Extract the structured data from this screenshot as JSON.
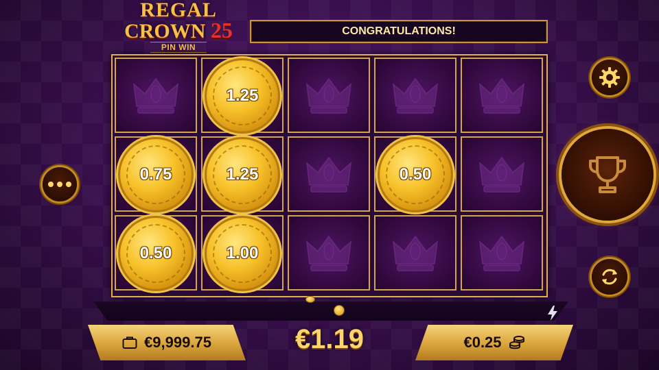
{
  "logo": {
    "line1": "REGAL",
    "line2": "CROWN",
    "number": "25",
    "tagline": "PIN WIN"
  },
  "banner": {
    "text": "CONGRATULATIONS!"
  },
  "grid": {
    "columns": 5,
    "rows": 3,
    "coins": [
      {
        "row": 0,
        "col": 1,
        "value": "1.25"
      },
      {
        "row": 1,
        "col": 0,
        "value": "0.75"
      },
      {
        "row": 1,
        "col": 1,
        "value": "1.25"
      },
      {
        "row": 1,
        "col": 3,
        "value": "0.50"
      },
      {
        "row": 2,
        "col": 0,
        "value": "0.50"
      },
      {
        "row": 2,
        "col": 1,
        "value": "1.00"
      }
    ],
    "empty_symbol": "crown-icon"
  },
  "footer": {
    "balance": "€9,999.75",
    "win": "€1.19",
    "bet": "€0.25"
  },
  "icons": {
    "more": "more-dots-icon",
    "settings": "gear-icon",
    "spin": "trophy-icon",
    "autoplay": "refresh-icon",
    "balance": "briefcase-icon",
    "bet": "coin-stack-icon",
    "turbo": "lightning-icon"
  },
  "colors": {
    "gold": "#e2b04e",
    "purple": "#3a0f4f",
    "banner_text": "#ffe9a8"
  }
}
